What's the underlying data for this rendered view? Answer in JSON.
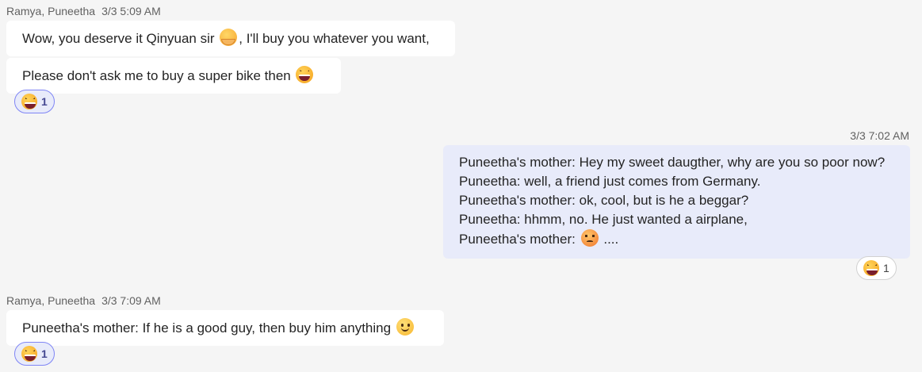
{
  "messages": [
    {
      "sender": "Ramya, Puneetha",
      "time": "3/3 5:09 AM",
      "bubble1": {
        "before": "Wow, you deserve it Qinyuan sir",
        "emoji": "hugging-face-icon",
        "after": ", I'll buy you whatever you want,"
      },
      "bubble2": {
        "text": "Please don't ask me to buy a super bike then",
        "emoji": "laughing-squint-icon"
      },
      "reaction": {
        "emoji": "laughing-squint-icon",
        "count": "1"
      }
    },
    {
      "sender": "",
      "time": "3/3 7:02 AM",
      "lines": [
        "Puneetha's mother: Hey my sweet daugther, why are you so poor now?",
        "Puneetha: well, a friend just comes from Germany.",
        "Puneetha's mother: ok, cool, but is he a beggar?",
        "Puneetha: hhmm, no. He just wanted a airplane,"
      ],
      "last_line": {
        "before": "Puneetha's mother:",
        "emoji": "angry-face-icon",
        "after": "...."
      },
      "reaction": {
        "emoji": "laughing-squint-icon",
        "count": "1"
      }
    },
    {
      "sender": "Ramya, Puneetha",
      "time": "3/3 7:09 AM",
      "bubble1": {
        "text": "Puneetha's mother: If he is a good guy, then buy him anything",
        "emoji": "smiling-face-icon"
      },
      "reaction": {
        "emoji": "laughing-squint-icon",
        "count": "1"
      }
    }
  ]
}
